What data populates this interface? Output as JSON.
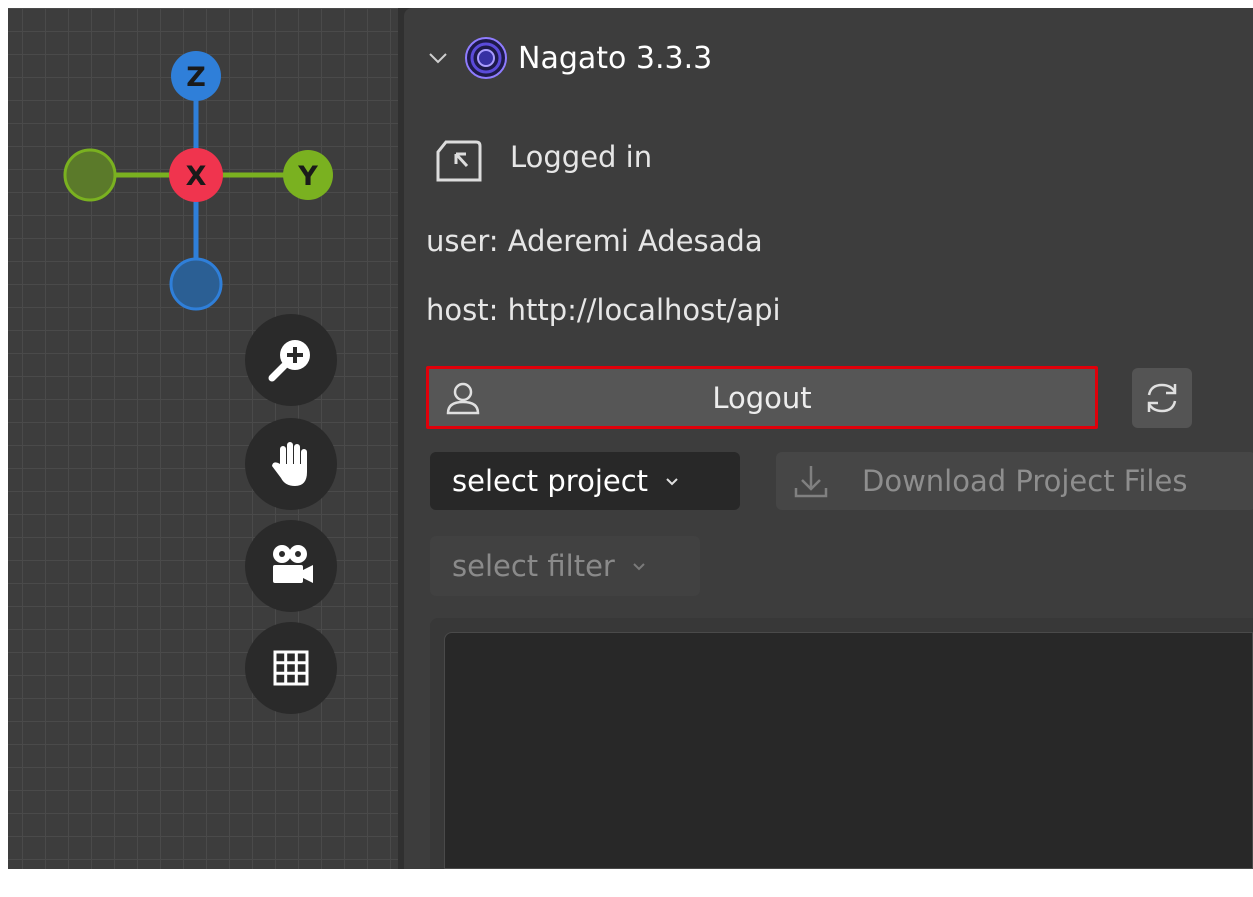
{
  "gizmo": {
    "axis_z_label": "Z",
    "axis_x_label": "X",
    "axis_y_label": "Y",
    "colors": {
      "z": "#2f7fd9",
      "x": "#f0344e",
      "y": "#7ab120"
    }
  },
  "nav_buttons": [
    {
      "icon": "zoom-in-icon"
    },
    {
      "icon": "pan-hand-icon"
    },
    {
      "icon": "camera-icon"
    },
    {
      "icon": "grid-icon"
    }
  ],
  "addon": {
    "title": "Nagato 3.3.3",
    "login_status": "Logged in",
    "user_line": "user: Aderemi Adesada",
    "host_line": "host: http://localhost/api",
    "logout_label": "Logout",
    "project_select": "select project",
    "download_label": "Download Project Files",
    "filter_select": "select filter",
    "highlight_color": "#e0000a"
  }
}
